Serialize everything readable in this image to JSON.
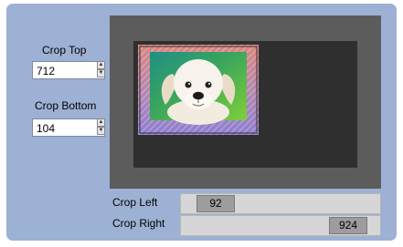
{
  "crop_top": {
    "label": "Crop Top",
    "value": "712"
  },
  "crop_bottom": {
    "label": "Crop Bottom",
    "value": "104"
  },
  "crop_left": {
    "label": "Crop Left",
    "value": "92"
  },
  "crop_right": {
    "label": "Crop Right",
    "value": "924"
  },
  "icons": {
    "up": "spinner-up-arrow-icon",
    "down": "spinner-down-arrow-icon"
  },
  "colors": {
    "panel": "#9cb1d4",
    "preview_outer": "#5c5c5c",
    "preview_inner": "#2f2f2f"
  }
}
